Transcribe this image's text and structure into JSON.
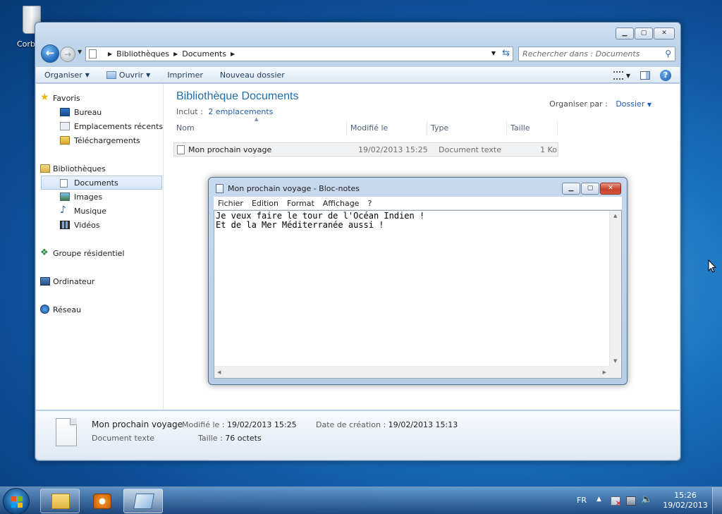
{
  "desktop": {
    "recycle_label": "Corb"
  },
  "explorer": {
    "breadcrumb": [
      "Bibliothèques",
      "Documents"
    ],
    "search_placeholder": "Rechercher dans : Documents",
    "toolbar": {
      "organize": "Organiser",
      "open": "Ouvrir",
      "print": "Imprimer",
      "new_folder": "Nouveau dossier"
    },
    "nav": {
      "favorites": "Favoris",
      "favorites_items": [
        "Bureau",
        "Emplacements récents",
        "Téléchargements"
      ],
      "libraries": "Bibliothèques",
      "libraries_items": [
        "Documents",
        "Images",
        "Musique",
        "Vidéos"
      ],
      "homegroup": "Groupe résidentiel",
      "computer": "Ordinateur",
      "network": "Réseau"
    },
    "library_title": "Bibliothèque Documents",
    "included_label": "Inclut :",
    "included_link": "2 emplacements",
    "arrange_label": "Organiser par :",
    "arrange_value": "Dossier",
    "columns": [
      "Nom",
      "Modifié le",
      "Type",
      "Taille"
    ],
    "files": [
      {
        "name": "Mon prochain voyage",
        "modified": "19/02/2013 15:25",
        "type": "Document texte",
        "size": "1 Ko"
      }
    ],
    "details": {
      "name": "Mon prochain voyage",
      "type": "Document texte",
      "modified_label": "Modifié le :",
      "modified_value": "19/02/2013 15:25",
      "size_label": "Taille :",
      "size_value": "76 octets",
      "created_label": "Date de création :",
      "created_value": "19/02/2013 15:13"
    }
  },
  "notepad": {
    "title": "Mon prochain voyage - Bloc-notes",
    "menu": [
      "Fichier",
      "Edition",
      "Format",
      "Affichage",
      "?"
    ],
    "content": "Je veux faire le tour de l'Océan Indien !\nEt de la Mer Méditerranée aussi !"
  },
  "taskbar": {
    "language": "FR",
    "time": "15:26",
    "date": "19/02/2013"
  }
}
